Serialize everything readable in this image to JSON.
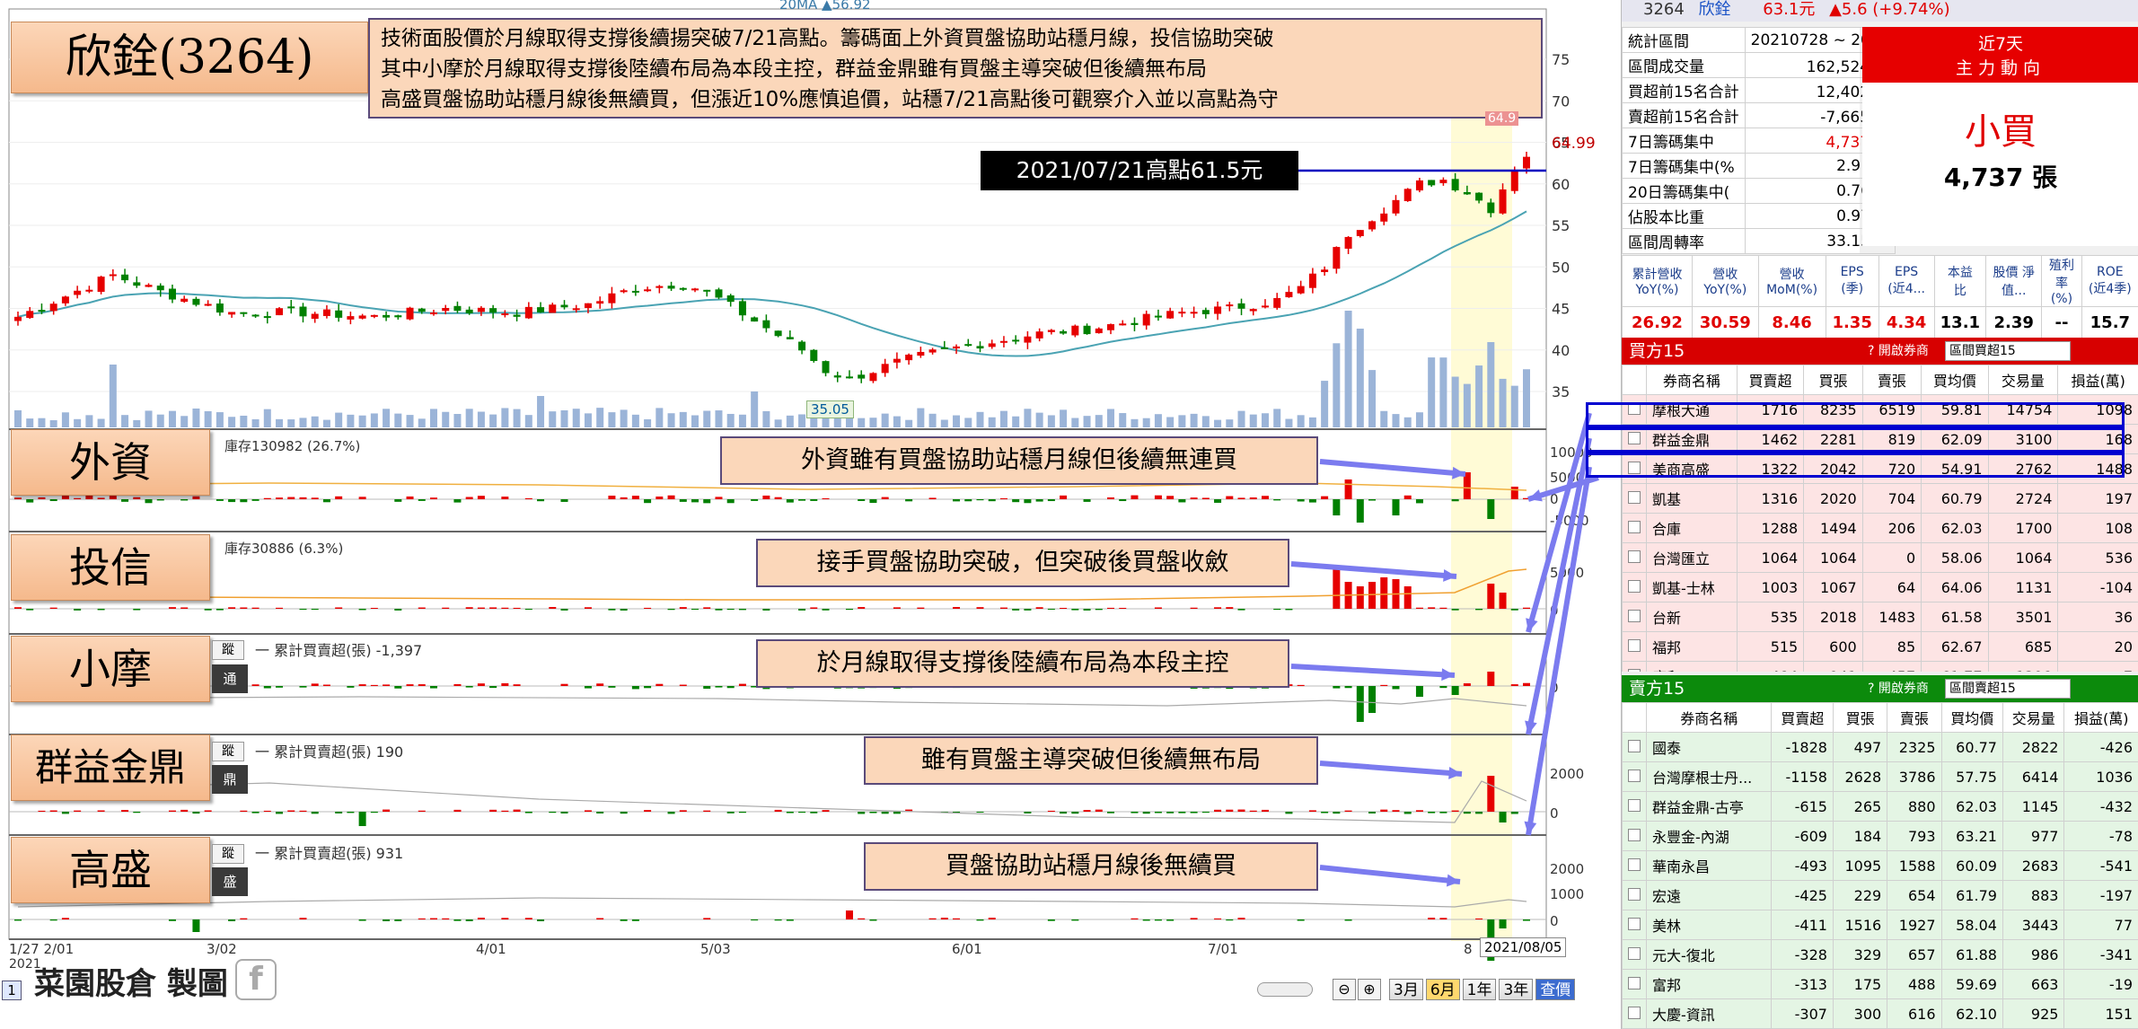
{
  "title": "欣銓(3264)",
  "summary_lines": [
    "技術面股價於月線取得支撐後續揚突破7/21高點。籌碼面上外資買盤協助站穩月線，投信協助突破",
    "其中小摩於月線取得支撐後陸續布局為本段主控，群益金鼎雖有買盤主導突破但後續無布局",
    "高盛買盤協助站穩月線後無續買，但漲近10%應慎追價，站穩7/21高點後可觀察介入並以高點為守"
  ],
  "ma_legend": "20MA ▲56.92",
  "high_label": "2021/07/21高點61.5元",
  "low_label": "35.05",
  "last_price_label": "64.99",
  "top_price_label": "64.9",
  "price_ticks": [
    "75",
    "70",
    "65",
    "60",
    "55",
    "50",
    "45",
    "40",
    "35"
  ],
  "panels": [
    {
      "title": "外資",
      "info": "庫存130982 (26.7%)",
      "callout": "外資雖有買盤協助站穩月線但後續無連買",
      "ticks": [
        "10000",
        "5000",
        "0",
        "-5000"
      ]
    },
    {
      "title": "投信",
      "info": "庫存30886 (6.3%)",
      "callout": "接手買盤協助突破，但突破後買盤收斂",
      "ticks": [
        "5000",
        "0"
      ]
    },
    {
      "title": "小摩",
      "info": "一 累計買賣超(張) -1,397",
      "callout": "於月線取得支撐後陸續布局為本段主控",
      "ticks": [
        "0"
      ],
      "tag": "通",
      "btn": "蹤"
    },
    {
      "title": "群益金鼎",
      "info": "一 累計買賣超(張) 190",
      "callout": "雖有買盤主導突破但後續無布局",
      "ticks": [
        "2000",
        "0"
      ],
      "tag": "鼎",
      "btn": "蹤"
    },
    {
      "title": "高盛",
      "info": "一 累計買賣超(張) 931",
      "callout": "買盤協助站穩月線後無續買",
      "ticks": [
        "2000",
        "1000",
        "0"
      ],
      "tag": "盛",
      "btn": "蹤"
    }
  ],
  "x_axis": [
    "1/27 2/01",
    "3/02",
    "4/01",
    "5/03",
    "6/01",
    "7/01",
    "8"
  ],
  "x_axis_year": "2021",
  "end_date": "2021/08/05",
  "watermark": "菜園股倉 製圖",
  "bottom_buttons": [
    "3月",
    "6月",
    "1年",
    "3年",
    "查價"
  ],
  "page_num": "1",
  "stock": {
    "code": "3264",
    "name": "欣銓",
    "price": "63.1元",
    "change": "▲5.6 (+9.74%)"
  },
  "stats": [
    {
      "label": "統計區間",
      "value": "20210728 ~ 2021"
    },
    {
      "label": "區間成交量",
      "value": "162,524 張"
    },
    {
      "label": "買超前15名合計",
      "value": "12,402 張"
    },
    {
      "label": "賣超前15名合計",
      "value": "-7,665 張"
    },
    {
      "label": "7日籌碼集中",
      "value": "4,737 張"
    },
    {
      "label": "7日籌碼集中(%",
      "value": "2.91 %"
    },
    {
      "label": "20日籌碼集中(",
      "value": "0.76 %"
    },
    {
      "label": "佔股本比重",
      "value": "0.97 %"
    },
    {
      "label": "區間周轉率",
      "value": "33.15 %"
    }
  ],
  "active_box": {
    "line1": "近7天",
    "line2": "主力動向",
    "big": "小買",
    "amount": "4,737 張"
  },
  "fundamentals": {
    "headers": [
      "累計營收 YoY(%)",
      "營收 YoY(%)",
      "營收 MoM(%)",
      "EPS (季)",
      "EPS (近4...",
      "本益 比",
      "股價 淨值...",
      "殖利率 (%)",
      "ROE (近4季)"
    ],
    "values": [
      "26.92",
      "30.59",
      "8.46",
      "1.35",
      "4.34",
      "13.1",
      "2.39",
      "--",
      "15.7"
    ]
  },
  "buy_table": {
    "title": "買方15",
    "link": "? 開啟券商",
    "select": "區間買超15",
    "headers": [
      "券商名稱",
      "買賣超",
      "買張",
      "賣張",
      "買均價",
      "交易量",
      "損益(萬)"
    ],
    "rows": [
      [
        "摩根大通",
        "1716",
        "8235",
        "6519",
        "59.81",
        "14754",
        "1098"
      ],
      [
        "群益金鼎",
        "1462",
        "2281",
        "819",
        "62.09",
        "3100",
        "168"
      ],
      [
        "美商高盛",
        "1322",
        "2042",
        "720",
        "54.91",
        "2762",
        "1488"
      ],
      [
        "凱基",
        "1316",
        "2020",
        "704",
        "60.79",
        "2724",
        "197"
      ],
      [
        "合庫",
        "1288",
        "1494",
        "206",
        "62.03",
        "1700",
        "108"
      ],
      [
        "台灣匯立",
        "1064",
        "1064",
        "0",
        "58.06",
        "1064",
        "536"
      ],
      [
        "凱基-士林",
        "1003",
        "1067",
        "64",
        "64.06",
        "1131",
        "-104"
      ],
      [
        "台新",
        "535",
        "2018",
        "1483",
        "61.58",
        "3501",
        "36"
      ],
      [
        "福邦",
        "515",
        "600",
        "85",
        "62.67",
        "685",
        "20"
      ],
      [
        "康和",
        "484",
        "941",
        "457",
        "61.77",
        "1398",
        "-7"
      ]
    ]
  },
  "sell_table": {
    "title": "賣方15",
    "link": "? 開啟券商",
    "select": "區間賣超15",
    "headers": [
      "券商名稱",
      "買賣超",
      "買張",
      "賣張",
      "買均價",
      "交易量",
      "損益(萬)"
    ],
    "rows": [
      [
        "國泰",
        "-1828",
        "497",
        "2325",
        "60.77",
        "2822",
        "-426"
      ],
      [
        "台灣摩根士丹...",
        "-1158",
        "2628",
        "3786",
        "57.75",
        "6414",
        "1036"
      ],
      [
        "群益金鼎-古亭",
        "-615",
        "265",
        "880",
        "62.03",
        "1145",
        "-432"
      ],
      [
        "永豐金-內湖",
        "-609",
        "184",
        "793",
        "63.21",
        "977",
        "-78"
      ],
      [
        "華南永昌",
        "-493",
        "1095",
        "1588",
        "60.09",
        "2683",
        "-541"
      ],
      [
        "宏遠",
        "-425",
        "229",
        "654",
        "61.79",
        "883",
        "-197"
      ],
      [
        "美林",
        "-411",
        "1516",
        "1927",
        "58.04",
        "3443",
        "77"
      ],
      [
        "元大-復北",
        "-328",
        "329",
        "657",
        "61.88",
        "986",
        "-341"
      ],
      [
        "富邦",
        "-313",
        "175",
        "488",
        "59.69",
        "663",
        "-19"
      ],
      [
        "大慶-資訊",
        "-307",
        "300",
        "616",
        "62.10",
        "925",
        "151"
      ]
    ]
  },
  "colors": {
    "up": "#e60000",
    "down": "#008000",
    "ma": "#4aa3b3",
    "volume": "#9bb4d8",
    "highlight": "#fffbd6",
    "arrow": "#7b7bef",
    "box": "#0000d0"
  }
}
